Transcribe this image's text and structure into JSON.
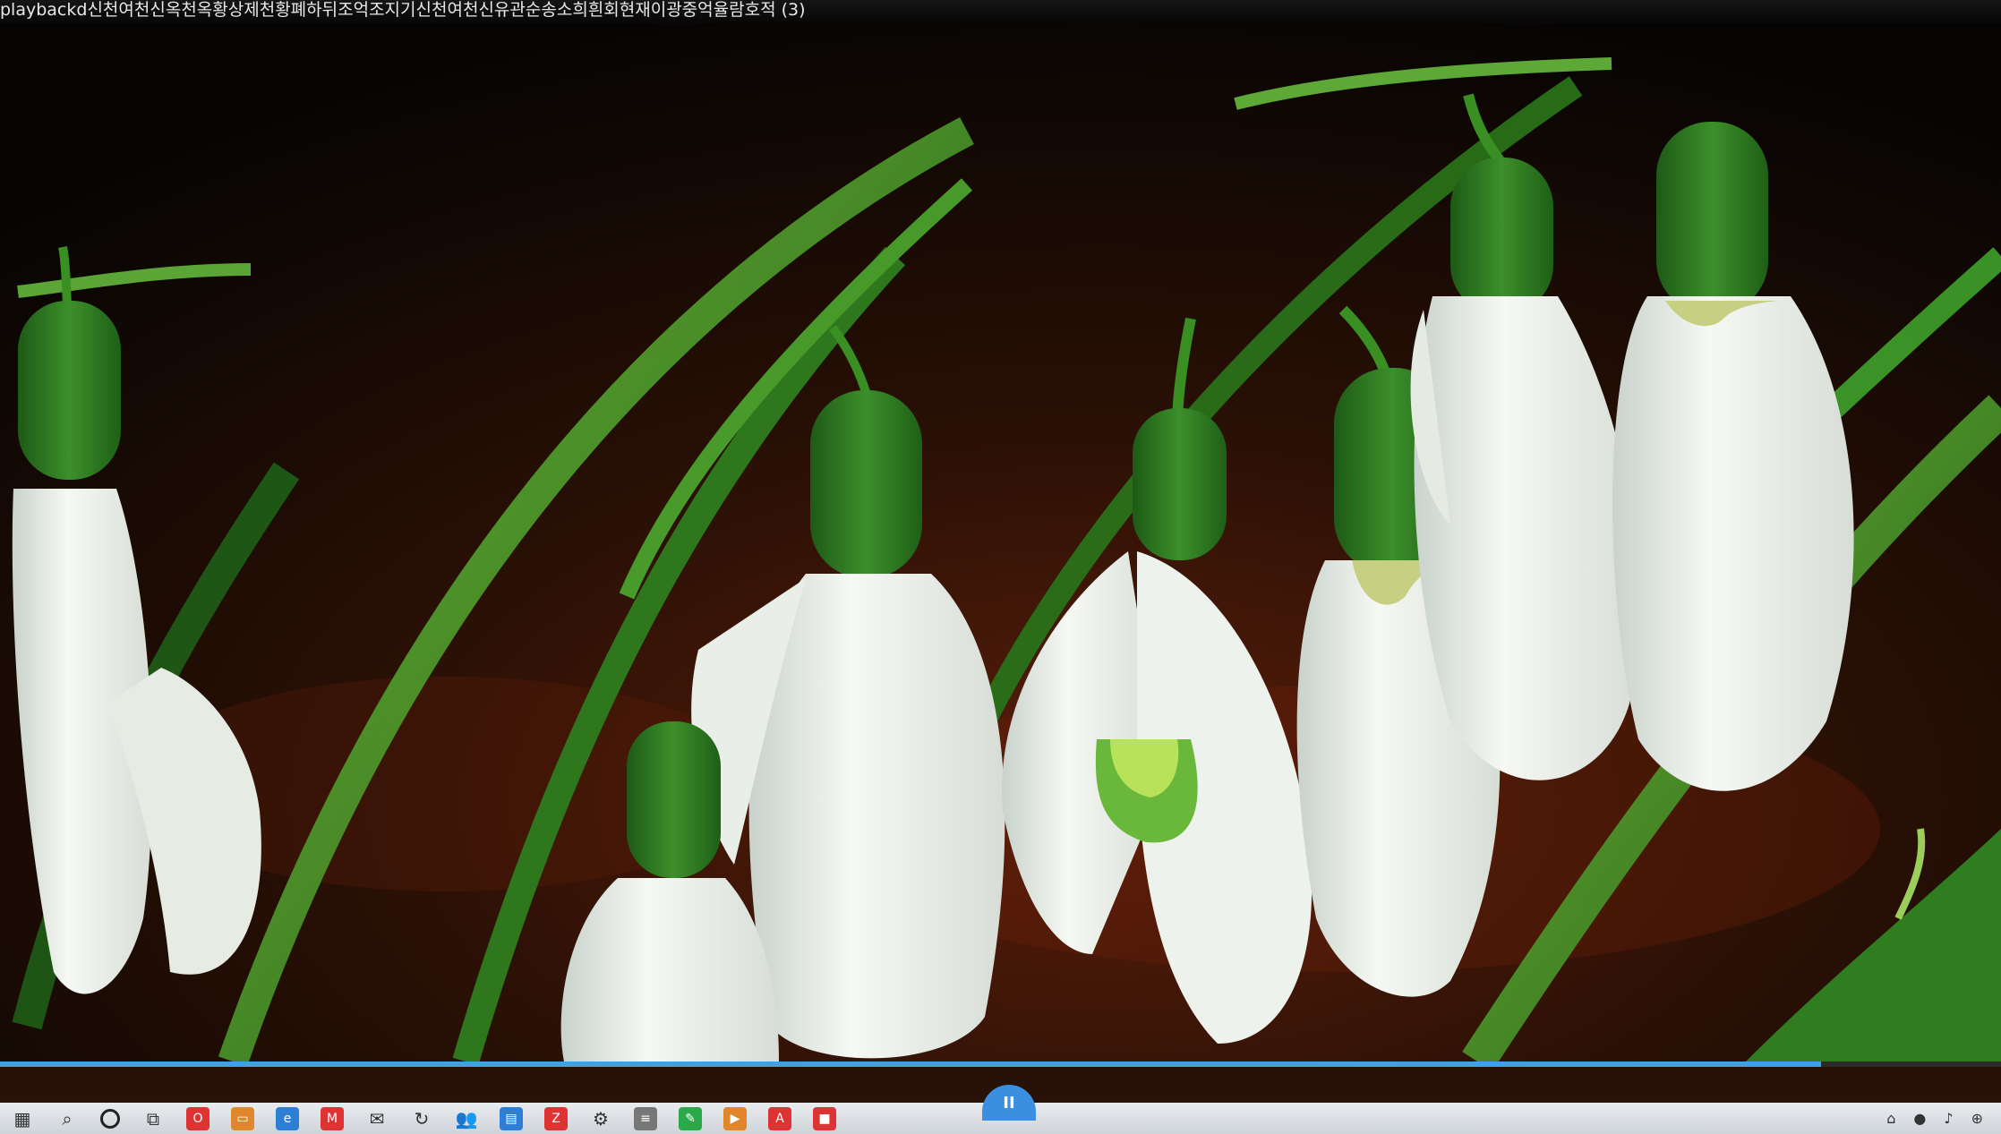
{
  "window": {
    "title": "playbackd신천여천신옥천옥황상제천황폐하뒤조억조지기신천여천신유관순송소희흰회현재이광중억율람호적 (3)"
  },
  "player": {
    "progress_fraction": 0.91,
    "handle_label": "II"
  },
  "taskbar": {
    "icons": [
      "start-icon",
      "search-icon",
      "task-view-icon",
      "office-icon",
      "file-explorer-icon",
      "edge-icon",
      "gmail-icon",
      "mail-icon",
      "refresh-icon",
      "people-icon",
      "calculator-icon",
      "filezilla-icon",
      "settings-icon",
      "notes-icon",
      "paint-icon",
      "media-icon",
      "pdf-icon",
      "app-icon"
    ]
  },
  "colors": {
    "accent": "#3aa3e8",
    "leaf_green": "#3f9a2a",
    "petal_white": "#f3f6f0"
  }
}
